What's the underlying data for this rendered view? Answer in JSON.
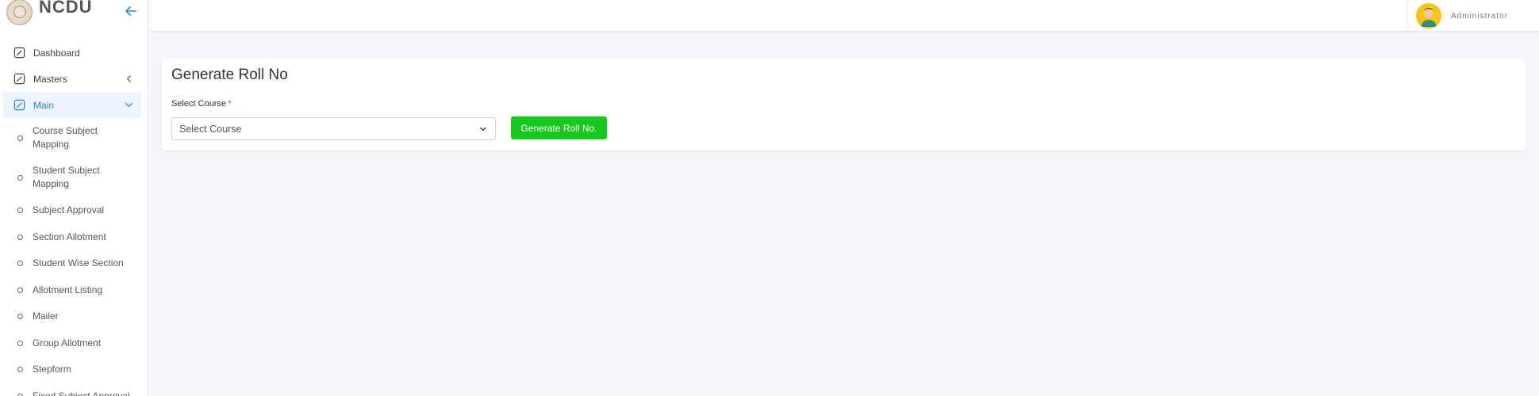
{
  "brand": {
    "name": "NCDU",
    "logo_icon": "university-seal-icon",
    "collapse_icon": "arrow-left-icon"
  },
  "colors": {
    "accent": "#2a86d6",
    "button_green": "#19c81e",
    "required": "#e53935"
  },
  "sidebar": {
    "items": [
      {
        "label": "Dashboard",
        "icon": "edit-square-icon"
      },
      {
        "label": "Masters",
        "icon": "edit-square-icon",
        "chevron": "chevron-left-icon"
      },
      {
        "label": "Main",
        "icon": "edit-square-icon",
        "chevron": "chevron-down-icon",
        "active": true
      }
    ],
    "sub_items": [
      {
        "label": "Course Subject Mapping"
      },
      {
        "label": "Student Subject Mapping"
      },
      {
        "label": "Subject Approval"
      },
      {
        "label": "Section Allotment"
      },
      {
        "label": "Student Wise Section"
      },
      {
        "label": "Allotment Listing"
      },
      {
        "label": "Mailer"
      },
      {
        "label": "Group Allotment"
      },
      {
        "label": "Stepform"
      },
      {
        "label": "Fixed Subject Approval"
      }
    ]
  },
  "topbar": {
    "user_name": "Administrator",
    "avatar_icon": "user-avatar-icon"
  },
  "main": {
    "title": "Generate Roll No",
    "course_label": "Select Course",
    "required_mark": "*",
    "course_select_value": "Select Course",
    "generate_button": "Generate Roll No."
  }
}
